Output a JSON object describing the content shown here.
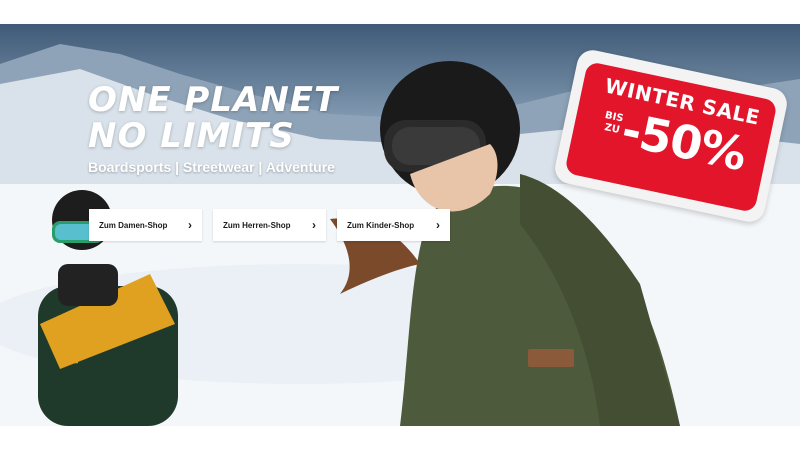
{
  "hero": {
    "headline_line1": "ONE PLANET",
    "headline_line2": "NO LIMITS",
    "tagline": "Boardsports | Streetwear | Adventure"
  },
  "buttons": [
    {
      "label": "Zum Damen-Shop",
      "icon": "chevron-right-icon"
    },
    {
      "label": "Zum Herren-Shop",
      "icon": "chevron-right-icon"
    },
    {
      "label": "Zum Kinder-Shop",
      "icon": "chevron-right-icon"
    }
  ],
  "badge": {
    "title": "WINTER SALE",
    "prefix_line1": "BIS",
    "prefix_line2": "ZU",
    "discount": "-50%",
    "color": "#e3152b"
  },
  "colors": {
    "sky_dark": "#3f5a77",
    "snow": "#f7f9fb",
    "jacket_olive": "#4e5a3c",
    "jacket_yellow": "#e0a020"
  }
}
